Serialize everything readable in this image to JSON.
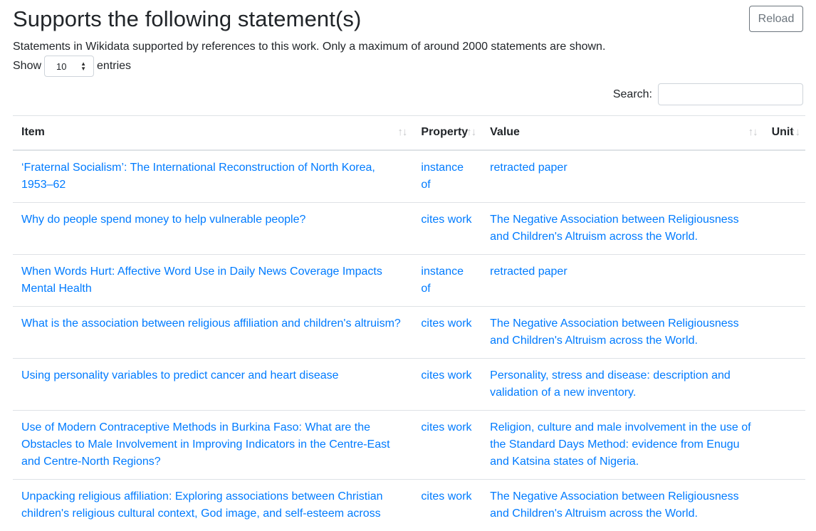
{
  "page": {
    "title": "Supports the following statement(s)",
    "reload_label": "Reload",
    "description": "Statements in Wikidata supported by references to this work. Only a maximum of around 2000 statements are shown.",
    "show_label": "Show",
    "entries_value": "10",
    "entries_label": "entries",
    "search_label": "Search:",
    "search_value": ""
  },
  "table": {
    "columns": [
      "Item",
      "Property",
      "Value",
      "Unit"
    ],
    "rows": [
      {
        "item": "‘Fraternal Socialism’: The International Reconstruction of North Korea, 1953–62",
        "property": "instance of",
        "value": "retracted paper",
        "unit": ""
      },
      {
        "item": "Why do people spend money to help vulnerable people?",
        "property": "cites work",
        "value": "The Negative Association between Religiousness and Children's Altruism across the World.",
        "unit": ""
      },
      {
        "item": "When Words Hurt: Affective Word Use in Daily News Coverage Impacts Mental Health",
        "property": "instance of",
        "value": "retracted paper",
        "unit": ""
      },
      {
        "item": "What is the association between religious affiliation and children's altruism?",
        "property": "cites work",
        "value": "The Negative Association between Religiousness and Children's Altruism across the World.",
        "unit": ""
      },
      {
        "item": "Using personality variables to predict cancer and heart disease",
        "property": "cites work",
        "value": "Personality, stress and disease: description and validation of a new inventory.",
        "unit": ""
      },
      {
        "item": "Use of Modern Contraceptive Methods in Burkina Faso: What are the Obstacles to Male Involvement in Improving Indicators in the Centre-East and Centre-North Regions?",
        "property": "cites work",
        "value": "Religion, culture and male involvement in the use of the Standard Days Method: evidence from Enugu and Katsina states of Nigeria.",
        "unit": ""
      },
      {
        "item": "Unpacking religious affiliation: Exploring associations between Christian children's religious cultural context, God image, and self-esteem across",
        "property": "cites work",
        "value": "The Negative Association between Religiousness and Children's Altruism across the World.",
        "unit": ""
      }
    ]
  },
  "colors": {
    "link": "#007bff",
    "border": "#dee2e6",
    "reload_border": "#6c757d"
  }
}
